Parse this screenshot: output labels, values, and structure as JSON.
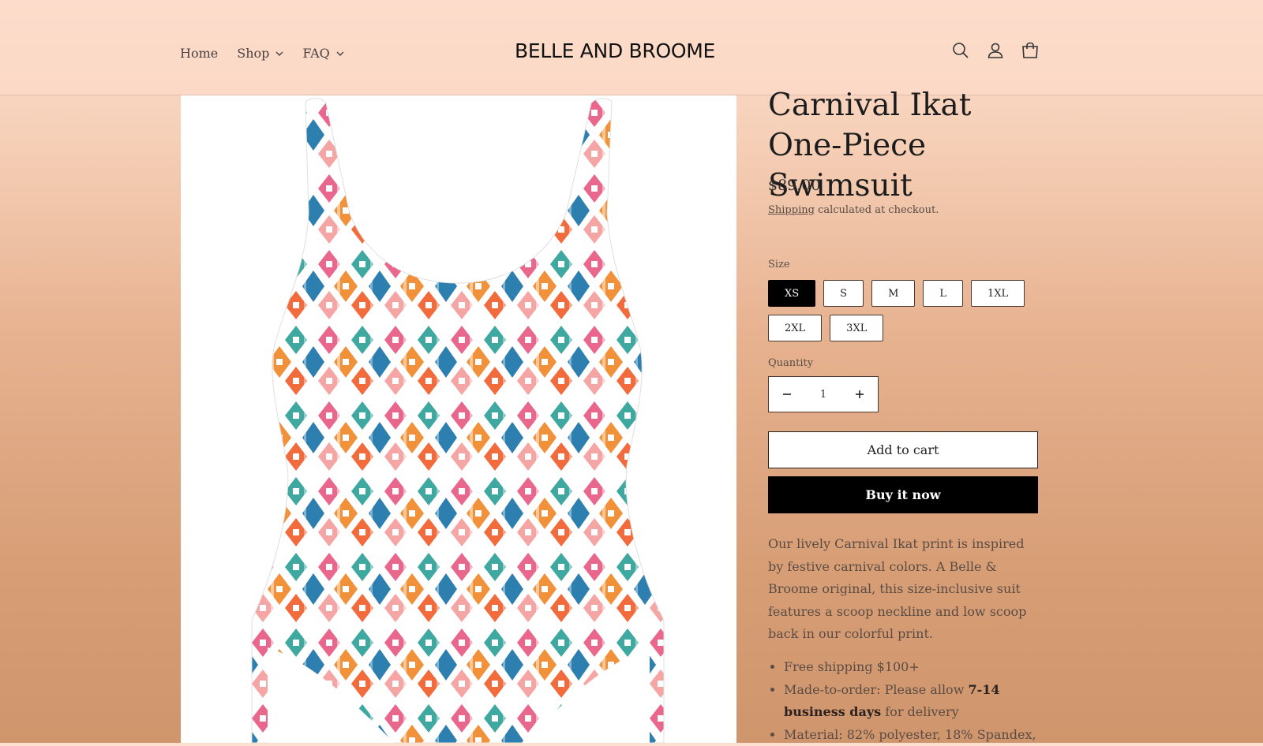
{
  "header": {
    "nav": [
      {
        "label": "Home",
        "has_dropdown": false
      },
      {
        "label": "Shop",
        "has_dropdown": true
      },
      {
        "label": "FAQ",
        "has_dropdown": true
      }
    ],
    "logo_text": "BELLE AND BROOME",
    "icons": [
      "search-icon",
      "account-icon",
      "cart-icon"
    ]
  },
  "product": {
    "title": "Carnival Ikat One-Piece Swimsuit",
    "price": "$89.00",
    "shipping_link": "Shipping",
    "shipping_text": " calculated at checkout.",
    "size_label": "Size",
    "sizes": [
      "XS",
      "S",
      "M",
      "L",
      "1XL",
      "2XL",
      "3XL"
    ],
    "selected_size": "XS",
    "quantity_label": "Quantity",
    "quantity": "1",
    "add_to_cart": "Add to cart",
    "buy_now": "Buy it now",
    "description": "Our lively Carnival Ikat print is inspired by festive carnival colors. A Belle & Broome original, this size-inclusive suit features a scoop neckline and low scoop back in our colorful print.",
    "bullets": {
      "b1": "Free shipping $100+",
      "b2_pre": "Made-to-order: Please allow ",
      "b2_bold": "7-14 business days",
      "b2_post": " for delivery",
      "b3": "Material: 82% polyester, 18% Spandex,"
    }
  },
  "colors": {
    "accent": "#000000",
    "background_top": "#fde0d0",
    "background_bottom": "#cf956c",
    "print_colors": [
      "#e9668d",
      "#f1923a",
      "#3fa8a0",
      "#2d7fb0",
      "#f6a5a5",
      "#f26b3c"
    ]
  }
}
